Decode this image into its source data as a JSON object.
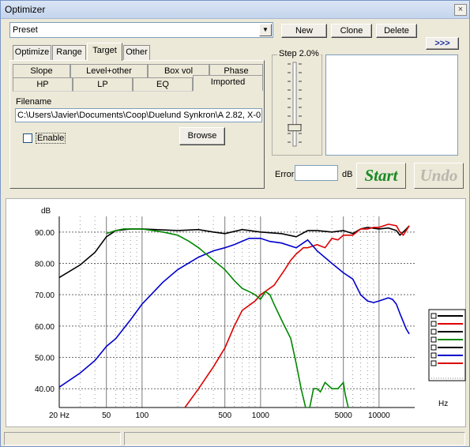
{
  "window": {
    "title": "Optimizer",
    "close_glyph": "×"
  },
  "preset": {
    "value": "Preset"
  },
  "buttons": {
    "new": "New",
    "clone": "Clone",
    "delete": "Delete",
    "expand": ">>>",
    "browse": "Browse",
    "start": "Start",
    "undo": "Undo"
  },
  "tabs": [
    {
      "label": "Optimize"
    },
    {
      "label": "Range"
    },
    {
      "label": "Target",
      "active": true
    },
    {
      "label": "Other"
    }
  ],
  "subtabs_row1": [
    {
      "label": "Slope"
    },
    {
      "label": "Level+other"
    },
    {
      "label": "Box vol"
    },
    {
      "label": "Phase"
    }
  ],
  "subtabs_row2": [
    {
      "label": "HP"
    },
    {
      "label": "LP"
    },
    {
      "label": "EQ"
    },
    {
      "label": "Imported",
      "active": true
    }
  ],
  "filename": {
    "label": "Filename",
    "value": "C:\\Users\\Javier\\Documents\\Coop\\Duelund Synkron\\A 2.82, X-0"
  },
  "enable": {
    "label": "Enable",
    "checked": false
  },
  "step": {
    "label": "Step 2.0%",
    "level": 0.78
  },
  "error": {
    "label": "Error",
    "value": "",
    "unit": "dB"
  },
  "colors": {
    "black": "#000000",
    "red": "#dd0000",
    "blue": "#0000cc",
    "green": "#008800",
    "start": "#1a8a25",
    "undo": "#b9b7ae"
  },
  "chart_data": {
    "type": "line",
    "ylabel": "dB",
    "xlabel": "Hz",
    "x_scale": "log",
    "xlim": [
      20,
      20000
    ],
    "ylim": [
      34,
      95
    ],
    "y_ticks": [
      "90.00",
      "80.00",
      "70.00",
      "60.00",
      "50.00",
      "40.00"
    ],
    "y_tick_values": [
      90,
      80,
      70,
      60,
      50,
      40
    ],
    "x_ticks": [
      "20 Hz",
      "50",
      "100",
      "500",
      "1000",
      "5000",
      "10000"
    ],
    "x_tick_values": [
      20,
      50,
      100,
      500,
      1000,
      5000,
      10000
    ],
    "grid": true,
    "legend_placement": "right",
    "series": [
      {
        "color": "#000000",
        "points": [
          [
            20,
            75.5
          ],
          [
            30,
            79.5
          ],
          [
            40,
            83.5
          ],
          [
            50,
            88.5
          ],
          [
            60,
            90.5
          ],
          [
            80,
            91
          ],
          [
            100,
            91
          ],
          [
            200,
            90.5
          ],
          [
            300,
            90.8
          ],
          [
            400,
            90
          ],
          [
            500,
            89.5
          ],
          [
            700,
            90.8
          ],
          [
            1000,
            90
          ],
          [
            1500,
            89.5
          ],
          [
            2000,
            88.5
          ],
          [
            2500,
            90.5
          ],
          [
            3000,
            90.5
          ],
          [
            4000,
            90
          ],
          [
            5000,
            90.5
          ],
          [
            6000,
            89.5
          ],
          [
            7000,
            91
          ],
          [
            8000,
            91.5
          ],
          [
            10000,
            91
          ],
          [
            12000,
            91.3
          ],
          [
            14000,
            90.5
          ],
          [
            15000,
            89
          ],
          [
            17000,
            91
          ],
          [
            18000,
            92
          ]
        ]
      },
      {
        "color": "#dd0000",
        "points": [
          [
            230,
            34
          ],
          [
            300,
            40
          ],
          [
            400,
            47
          ],
          [
            500,
            53
          ],
          [
            600,
            60
          ],
          [
            700,
            65
          ],
          [
            900,
            68
          ],
          [
            1000,
            70
          ],
          [
            1300,
            73
          ],
          [
            1600,
            78
          ],
          [
            1800,
            81
          ],
          [
            2000,
            83
          ],
          [
            2300,
            85
          ],
          [
            2500,
            85
          ],
          [
            3000,
            86
          ],
          [
            3500,
            85
          ],
          [
            4000,
            88
          ],
          [
            4500,
            87.5
          ],
          [
            5000,
            89
          ],
          [
            6000,
            89
          ],
          [
            7000,
            91
          ],
          [
            8000,
            91
          ],
          [
            9000,
            91.5
          ],
          [
            10000,
            91.5
          ],
          [
            12000,
            92.5
          ],
          [
            14000,
            92
          ],
          [
            15000,
            90
          ],
          [
            16000,
            89
          ],
          [
            18000,
            92
          ]
        ]
      },
      {
        "color": "#0000cc",
        "points": [
          [
            20,
            40.5
          ],
          [
            30,
            45
          ],
          [
            40,
            49
          ],
          [
            50,
            53.5
          ],
          [
            60,
            56
          ],
          [
            80,
            62
          ],
          [
            100,
            67
          ],
          [
            150,
            74
          ],
          [
            200,
            78
          ],
          [
            300,
            82
          ],
          [
            400,
            84
          ],
          [
            500,
            85
          ],
          [
            600,
            86
          ],
          [
            800,
            88
          ],
          [
            1000,
            88
          ],
          [
            1200,
            87
          ],
          [
            1500,
            86.5
          ],
          [
            2000,
            85
          ],
          [
            2500,
            87.5
          ],
          [
            3000,
            84
          ],
          [
            4000,
            80
          ],
          [
            5000,
            77
          ],
          [
            6000,
            75
          ],
          [
            7000,
            70
          ],
          [
            8000,
            68
          ],
          [
            9000,
            67.5
          ],
          [
            10000,
            68
          ],
          [
            12000,
            69
          ],
          [
            13000,
            68.5
          ],
          [
            14000,
            67
          ],
          [
            15000,
            64
          ],
          [
            17000,
            59
          ],
          [
            18000,
            57.5
          ]
        ]
      },
      {
        "color": "#008800",
        "points": [
          [
            50,
            89.5
          ],
          [
            60,
            90.5
          ],
          [
            70,
            91
          ],
          [
            100,
            91
          ],
          [
            150,
            90
          ],
          [
            200,
            89
          ],
          [
            250,
            87
          ],
          [
            300,
            85
          ],
          [
            400,
            81
          ],
          [
            500,
            78
          ],
          [
            600,
            74.5
          ],
          [
            700,
            72
          ],
          [
            800,
            71
          ],
          [
            900,
            70
          ],
          [
            1000,
            68.5
          ],
          [
            1100,
            71
          ],
          [
            1200,
            70
          ],
          [
            1300,
            67
          ],
          [
            1500,
            62
          ],
          [
            1800,
            56
          ],
          [
            2000,
            48
          ],
          [
            2200,
            40
          ],
          [
            2400,
            34
          ],
          [
            2600,
            34
          ],
          [
            2800,
            40
          ],
          [
            3000,
            40
          ],
          [
            3200,
            39
          ],
          [
            3500,
            42
          ],
          [
            4000,
            40
          ],
          [
            4500,
            40
          ],
          [
            5000,
            42
          ],
          [
            5200,
            38
          ],
          [
            5500,
            34
          ]
        ]
      }
    ]
  }
}
